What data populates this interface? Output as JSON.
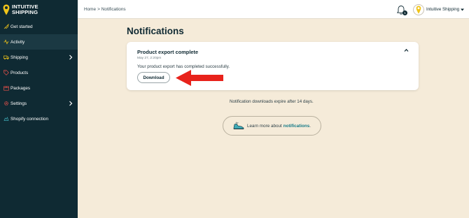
{
  "brand": {
    "name_line1": "INTUITIVE",
    "name_line2": "SHIPPING"
  },
  "sidebar": {
    "items": [
      {
        "label": "Get started",
        "icon": "rocket-icon"
      },
      {
        "label": "Activity",
        "icon": "activity-icon"
      },
      {
        "label": "Shipping",
        "icon": "truck-icon",
        "has_submenu": true
      },
      {
        "label": "Products",
        "icon": "tag-icon"
      },
      {
        "label": "Packages",
        "icon": "package-icon"
      },
      {
        "label": "Settings",
        "icon": "gear-icon",
        "has_submenu": true
      },
      {
        "label": "Shopify connection",
        "icon": "shopify-icon"
      }
    ]
  },
  "header": {
    "breadcrumb": [
      "Home",
      "Notifications"
    ],
    "breadcrumb_sep": ">",
    "notification_count": "1",
    "account_name": "Intuitive Shipping"
  },
  "main": {
    "title": "Notifications",
    "notification": {
      "title": "Product export complete",
      "time": "May 27, 2:20pm",
      "message": "Your product export has completed successfully.",
      "download_label": "Download"
    },
    "expire_note": "Notification downloads expire after 14 days.",
    "learn_more": {
      "prefix": "Learn more about",
      "link": "notifications",
      "suffix": "."
    }
  },
  "colors": {
    "sidebar_bg": "#0f2a33",
    "page_bg": "#f5ebd9",
    "accent": "#f0c419",
    "link": "#157a87",
    "annotation_arrow": "#e8221b"
  }
}
